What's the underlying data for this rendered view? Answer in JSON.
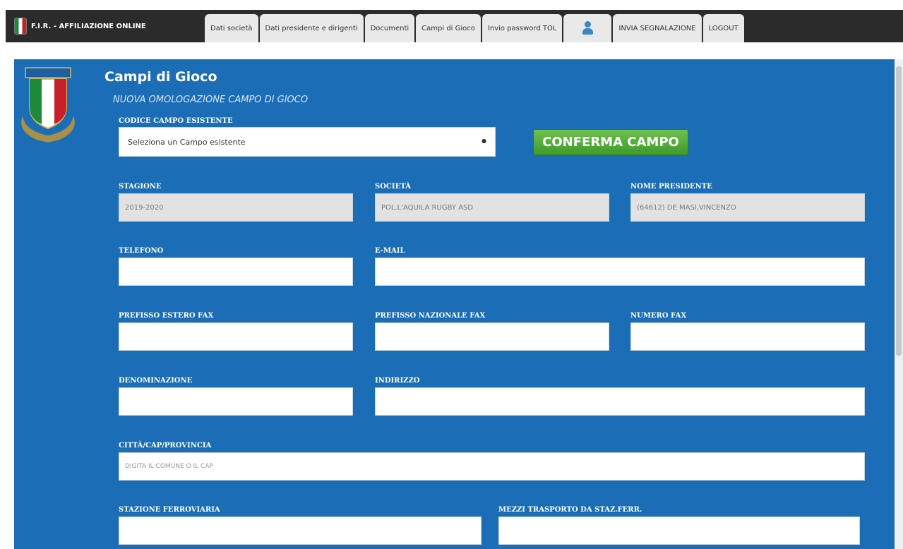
{
  "header": {
    "brand": "F.I.R. - AFFILIAZIONE ONLINE",
    "tabs": [
      {
        "label": "Dati società"
      },
      {
        "label": "Dati presidente e dirigenti"
      },
      {
        "label": "Documenti"
      },
      {
        "label": "Campi di Gioco"
      },
      {
        "label": "Invio password TOL"
      },
      {
        "label": ""
      },
      {
        "label": "INVIA SEGNALAZIONE"
      },
      {
        "label": "LOGOUT"
      }
    ]
  },
  "page": {
    "title": "Campi di Gioco",
    "subtitle": "NUOVA OMOLOGAZIONE CAMPO DI GIOCO"
  },
  "campo_esistente": {
    "label": "CODICE CAMPO ESISTENTE",
    "selected": "Seleziona un Campo esistente",
    "button": "CONFERMA CAMPO"
  },
  "fields": {
    "stagione": {
      "label": "STAGIONE",
      "value": "2019-2020"
    },
    "societa": {
      "label": "SOCIETÀ",
      "value": "POL.L'AQUILA RUGBY ASD"
    },
    "presidente": {
      "label": "NOME PRESIDENTE",
      "value": "(64612)  DE MASI,VINCENZO"
    },
    "telefono": {
      "label": "TELEFONO",
      "value": ""
    },
    "email": {
      "label": "E-MAIL",
      "value": ""
    },
    "pref_estero_fax": {
      "label": "PREFISSO ESTERO FAX",
      "value": ""
    },
    "pref_naz_fax": {
      "label": "PREFISSO NAZIONALE FAX",
      "value": ""
    },
    "numero_fax": {
      "label": "NUMERO FAX",
      "value": ""
    },
    "denominazione": {
      "label": "DENOMINAZIONE",
      "value": ""
    },
    "indirizzo": {
      "label": "INDIRIZZO",
      "value": ""
    },
    "citta": {
      "label": "CITTÀ/CAP/PROVINCIA",
      "placeholder": "DIGITA IL COMUNE O IL CAP"
    },
    "stazione": {
      "label": "STAZIONE FERROVIARIA",
      "value": ""
    },
    "mezzi": {
      "label": "MEZZI TRASPORTO DA STAZ.FERR.",
      "value": ""
    }
  },
  "colors": {
    "panel": "#1b6db5",
    "button": "#4ea636"
  }
}
